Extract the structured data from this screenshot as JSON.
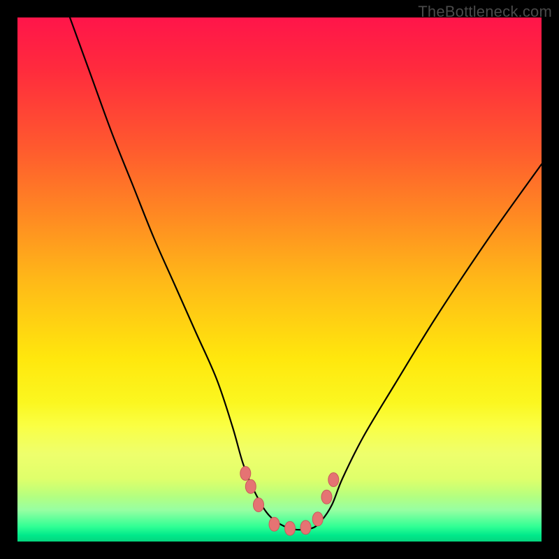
{
  "watermark": "TheBottleneck.com",
  "colors": {
    "frame": "#000000",
    "curve_stroke": "#000000",
    "marker_fill": "#e57373",
    "marker_stroke": "#c85a5a",
    "gradient_top": "#ff154a",
    "gradient_bottom": "#04d57e"
  },
  "chart_data": {
    "type": "line",
    "title": "",
    "xlabel": "",
    "ylabel": "",
    "xlim": [
      0,
      100
    ],
    "ylim": [
      0,
      100
    ],
    "grid": false,
    "legend": false,
    "description": "V-shaped bottleneck curve over a red-to-green vertical gradient background. Curve descends from top-left, bottoms out into a flat trough with salmon markers, then rises toward the right edge.",
    "series": [
      {
        "name": "bottleneck-curve",
        "x": [
          10,
          14,
          18,
          22,
          26,
          30,
          34,
          38,
          41,
          43,
          45,
          48,
          52,
          56,
          58,
          60,
          62,
          66,
          72,
          80,
          90,
          100
        ],
        "values": [
          100,
          89,
          78,
          68,
          58,
          49,
          40,
          31,
          22,
          15,
          10,
          5,
          2.5,
          2.5,
          4,
          7,
          12,
          20,
          30,
          43,
          58,
          72
        ]
      }
    ],
    "markers": {
      "name": "trough-markers",
      "x": [
        43.5,
        44.5,
        46.0,
        49.0,
        52.0,
        55.0,
        57.3,
        59.0,
        60.3
      ],
      "values": [
        13.0,
        10.5,
        7.0,
        3.3,
        2.5,
        2.7,
        4.3,
        8.5,
        11.8
      ]
    }
  }
}
